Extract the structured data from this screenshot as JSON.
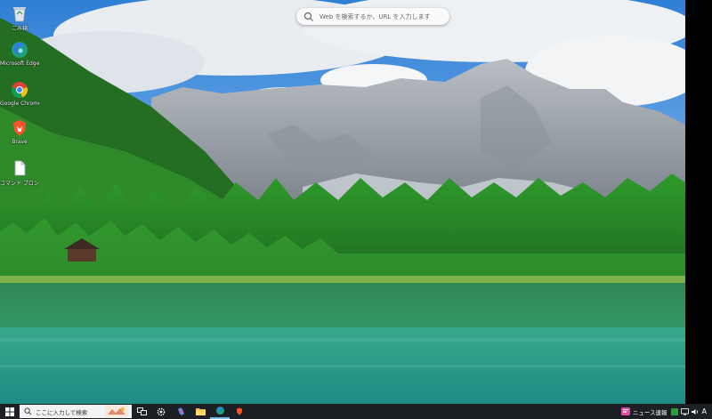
{
  "browser_widget": {
    "search_placeholder": "Web を検索するか、URL を入力します"
  },
  "desktop_icons": [
    {
      "label": "ごみ箱",
      "icon": "recycle-bin-icon"
    },
    {
      "label": "Microsoft Edge",
      "icon": "edge-icon"
    },
    {
      "label": "Google Chrome",
      "icon": "chrome-icon"
    },
    {
      "label": "Brave",
      "icon": "brave-icon"
    },
    {
      "label": "コマンド プロンプト",
      "icon": "file-icon"
    }
  ],
  "taskbar": {
    "search_placeholder": "ここに入力して検索",
    "news_label": "ニュース速報",
    "ime_label": "A",
    "apps": [
      "task-view-icon",
      "settings-icon",
      "copilot-icon",
      "file-explorer-icon",
      "edge-icon",
      "brave-icon"
    ]
  },
  "colors": {
    "taskbar": "#1c1f24",
    "sky": "#3b8ad9",
    "lake": "#2a9a8a",
    "forest": "#2e8f2a",
    "mountain": "#9aa0a6"
  }
}
